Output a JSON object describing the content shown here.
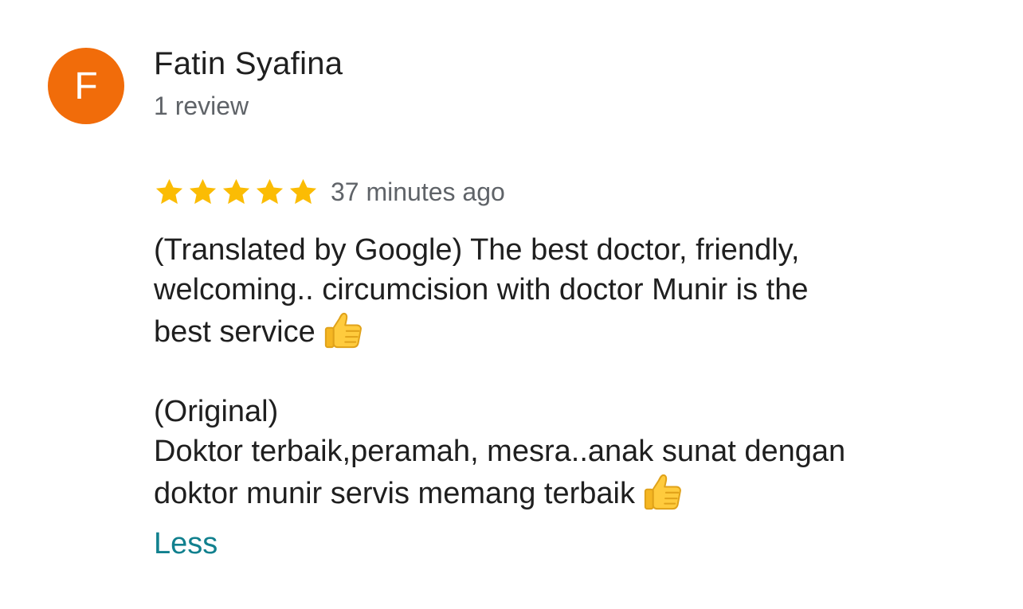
{
  "author": {
    "avatar_letter": "F",
    "avatar_color": "#F16C0A",
    "name": "Fatin Syafina",
    "review_count": "1 review"
  },
  "review": {
    "rating": 5,
    "max_rating": 5,
    "star_color": "#FBBC04",
    "timestamp": "37 minutes ago",
    "translated_line1": "(Translated by Google) The best doctor, friendly,",
    "translated_line2": "welcoming.. circumcision with doctor Munir is the",
    "translated_line3": "best service",
    "original_label": "(Original)",
    "original_line1": "Doktor terbaik,peramah, mesra..anak sunat dengan",
    "original_line2": "doktor munir servis memang terbaik",
    "emoji_icon": "thumbs-up-icon"
  },
  "actions": {
    "less_label": "Less",
    "link_color": "#11808E"
  }
}
